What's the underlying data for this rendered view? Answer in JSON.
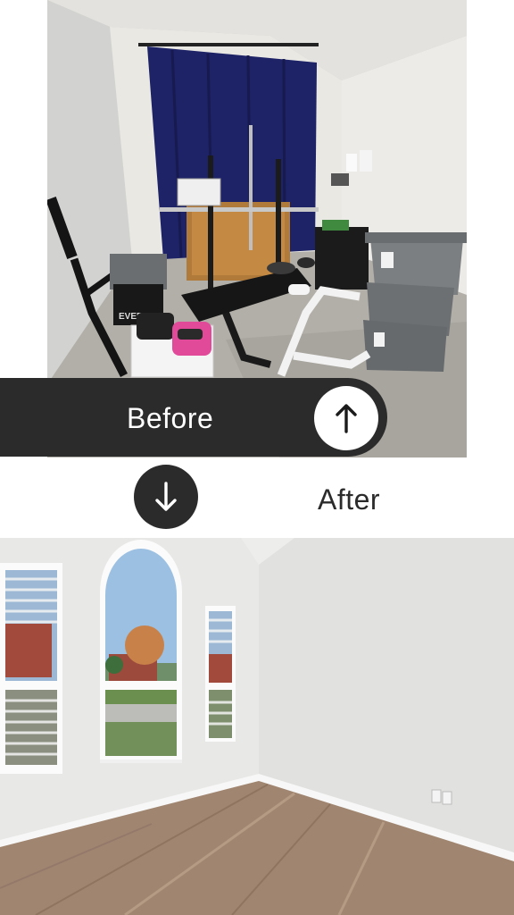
{
  "before": {
    "label": "Before",
    "arrow_icon": "arrow-up-icon"
  },
  "after": {
    "label": "After",
    "arrow_icon": "arrow-down-icon"
  },
  "photo_before": {
    "box_label": "EVERLAST"
  },
  "colors": {
    "dark_bar": "#2b2b2b",
    "label_light": "#ffffff",
    "label_dark": "#2b2b2b",
    "curtain": "#1d2366",
    "floor_wood": "#a08670"
  }
}
